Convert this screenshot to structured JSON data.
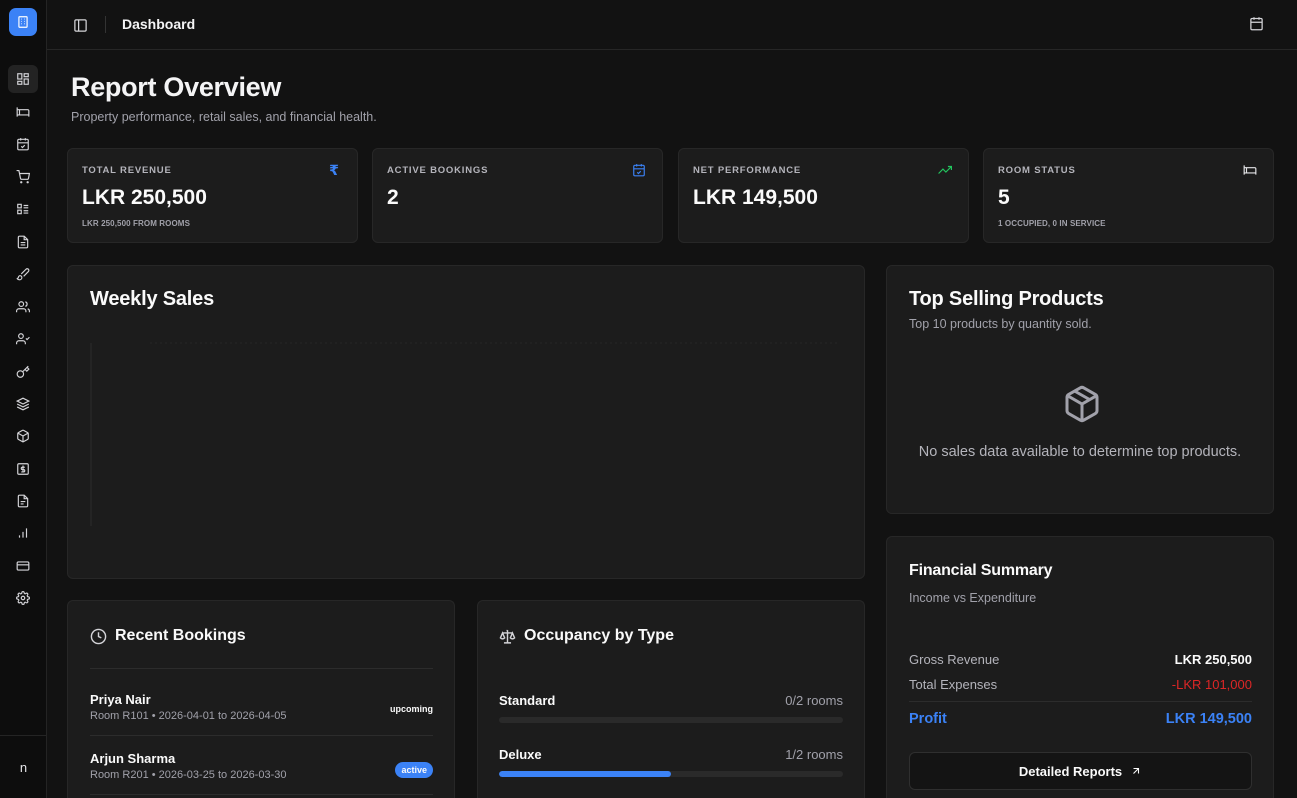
{
  "header": {
    "title": "Dashboard"
  },
  "page": {
    "title": "Report Overview",
    "subtitle": "Property performance, retail sales, and financial health."
  },
  "stats": [
    {
      "label": "TOTAL REVENUE",
      "value": "LKR 250,500",
      "sub": "LKR 250,500 FROM ROOMS",
      "icon": "rupee-icon",
      "icon_color": "#3b82f6"
    },
    {
      "label": "ACTIVE BOOKINGS",
      "value": "2",
      "sub": "",
      "icon": "calendar-check-icon",
      "icon_color": "#3b82f6"
    },
    {
      "label": "NET PERFORMANCE",
      "value": "LKR 149,500",
      "sub": "",
      "icon": "trending-up-icon",
      "icon_color": "#22c55e"
    },
    {
      "label": "ROOM STATUS",
      "value": "5",
      "sub": "1 OCCUPIED, 0 IN SERVICE",
      "icon": "bed-icon",
      "icon_color": "#e4e4e7"
    }
  ],
  "weekly_sales": {
    "title": "Weekly Sales"
  },
  "top_products": {
    "title": "Top Selling Products",
    "subtitle": "Top 10 products by quantity sold.",
    "empty_text": "No sales data available to determine top products."
  },
  "recent_bookings": {
    "title": "Recent Bookings",
    "items": [
      {
        "name": "Priya Nair",
        "detail": "Room R101 • 2026-04-01 to 2026-04-05",
        "status": "upcoming"
      },
      {
        "name": "Arjun Sharma",
        "detail": "Room R201 • 2026-03-25 to 2026-03-30",
        "status": "active"
      }
    ]
  },
  "occupancy": {
    "title": "Occupancy by Type",
    "rows": [
      {
        "label": "Standard",
        "count": "0/2 rooms",
        "fraction": 0
      },
      {
        "label": "Deluxe",
        "count": "1/2 rooms",
        "fraction": 0.5
      }
    ]
  },
  "financial": {
    "title": "Financial Summary",
    "subtitle": "Income vs Expenditure",
    "gross_label": "Gross Revenue",
    "gross_value": "LKR 250,500",
    "expenses_label": "Total Expenses",
    "expenses_value": "-LKR 101,000",
    "profit_label": "Profit",
    "profit_value": "LKR 149,500",
    "button_label": "Detailed Reports"
  },
  "sidebar": {
    "user_initial": "n",
    "accent": "#3b82f6",
    "icons": [
      "dashboard-icon",
      "bed-icon",
      "calendar-check-icon",
      "cart-icon",
      "list-icon",
      "document-icon",
      "brush-icon",
      "users-icon",
      "user-check-icon",
      "key-icon",
      "layers-icon",
      "package-icon",
      "dollar-icon",
      "report-icon",
      "bar-chart-icon",
      "credit-card-icon",
      "settings-icon"
    ]
  }
}
